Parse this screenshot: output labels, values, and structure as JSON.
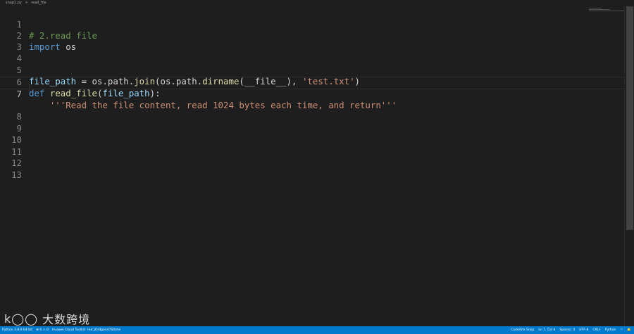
{
  "breadcrumb": {
    "file": "snap1.py",
    "separator": ">",
    "symbol": "read_file"
  },
  "editor": {
    "lines": [
      {
        "num": "1"
      },
      {
        "num": "2"
      },
      {
        "num": "3"
      },
      {
        "num": "4"
      },
      {
        "num": "5"
      },
      {
        "num": "6"
      },
      {
        "num": "7"
      },
      {
        "num": "8"
      },
      {
        "num": "9"
      },
      {
        "num": "10"
      },
      {
        "num": "11"
      },
      {
        "num": "12"
      },
      {
        "num": "13"
      }
    ],
    "code": {
      "l1": "# 2.read file",
      "l2a": "import",
      "l2b": " os",
      "l5a": "file_path",
      "l5b": " = os.path.",
      "l5c": "join",
      "l5d": "(os.path.",
      "l5e": "dirname",
      "l5f": "(__file__), ",
      "l5g": "'test.txt'",
      "l5h": ")",
      "l6a": "def",
      "l6b": " ",
      "l6c": "read_file",
      "l6d": "(",
      "l6e": "file_path",
      "l6f": "):",
      "l7a": "    ",
      "l7b": "'''Read the file content, read 1024 bytes each time, and return'''"
    },
    "current_line": 7
  },
  "watermark": {
    "logo": "k◯◯",
    "text": "大数跨境"
  },
  "statusbar": {
    "left": [
      "Python 3.8.0 64-bit",
      "⊗ 0 ⚠ 0",
      "Huawei Cloud Toolkit: Huf_jOrdgon47Sltims"
    ],
    "right": [
      "CodeArts Snap",
      "Ln 7, Col 4",
      "Spaces: 4",
      "UTF-8",
      "CRLF",
      "Python",
      "⚐",
      "🔔"
    ]
  },
  "colors": {
    "background": "#1e1e1e",
    "statusbar": "#007acc",
    "comment": "#6a9955",
    "keyword": "#569cd6",
    "function": "#dcdcaa",
    "string": "#ce9178",
    "variable": "#9cdcfe"
  }
}
